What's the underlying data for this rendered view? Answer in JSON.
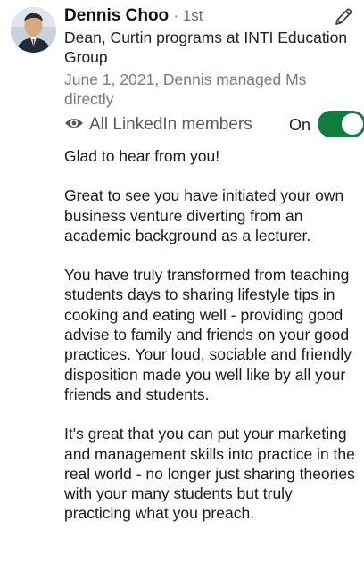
{
  "author": {
    "name": "Dennis Choo",
    "degree": "· 1st",
    "headline": "Dean, Curtin programs at INTI Education Group",
    "relationship": "June 1, 2021, Dennis managed Ms directly"
  },
  "visibility": {
    "label": "All LinkedIn members",
    "toggle_label": "On",
    "toggle_on": true
  },
  "icons": {
    "edit": "pencil-icon",
    "visibility": "eye-icon"
  },
  "colors": {
    "toggle_on": "#107c3e",
    "meta_text": "#7a7a7a"
  },
  "message": {
    "paragraphs": [
      "Glad to hear from you!",
      "Great to see you have initiated your own business venture diverting from an academic background as a lecturer.",
      "You have truly transformed from teaching students days to sharing lifestyle tips in cooking and eating well - providing good advise to family and friends on your good practices. Your loud, sociable and friendly disposition made you well like by all your friends and students.",
      "It's great that you can put your marketing and management skills into practice in the real world - no longer just sharing theories with your many students but truly practicing what you preach."
    ]
  }
}
